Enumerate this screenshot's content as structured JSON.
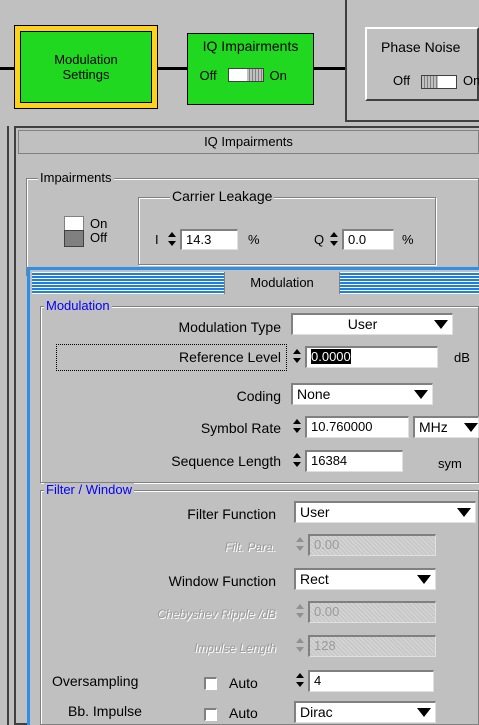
{
  "top": {
    "modulation_settings": [
      "Modulation",
      "Settings"
    ],
    "iq_impairments": {
      "title": "IQ Impairments",
      "off": "Off",
      "on": "On"
    },
    "phase_noise": {
      "title": "Phase Noise",
      "off": "Off",
      "on": "On"
    }
  },
  "iq_window": {
    "title": "IQ Impairments",
    "impairments_group": "Impairments",
    "switch": {
      "on": "On",
      "off": "Off"
    },
    "carrier_leakage": {
      "title": "Carrier Leakage",
      "i_label": "I",
      "i_value": "14.3",
      "i_unit": "%",
      "q_label": "Q",
      "q_value": "0.0",
      "q_unit": "%"
    }
  },
  "mod_window": {
    "title": "Modulation",
    "modulation_group": "Modulation",
    "modulation_type": {
      "label": "Modulation Type",
      "value": "User"
    },
    "reference_level": {
      "label": "Reference Level",
      "value": "0.0000",
      "unit": "dB"
    },
    "coding": {
      "label": "Coding",
      "value": "None"
    },
    "symbol_rate": {
      "label": "Symbol Rate",
      "value": "10.760000",
      "unit": "MHz"
    },
    "sequence_length": {
      "label": "Sequence Length",
      "value": "16384",
      "unit": "sym"
    },
    "filter_group": "Filter / Window",
    "filter_function": {
      "label": "Filter Function",
      "value": "User"
    },
    "filt_para": {
      "label": "Filt. Para.",
      "value": "0.00"
    },
    "window_function": {
      "label": "Window Function",
      "value": "Rect"
    },
    "chebyshev": {
      "label": "Chebyshev Ripple /dB",
      "value": "0.00"
    },
    "impulse_length": {
      "label": "Impulse Length",
      "value": "128"
    },
    "oversampling": {
      "label": "Oversampling",
      "auto": "Auto",
      "value": "4"
    },
    "bb_impulse": {
      "label": "Bb. Impulse",
      "auto": "Auto",
      "value": "Dirac"
    }
  }
}
